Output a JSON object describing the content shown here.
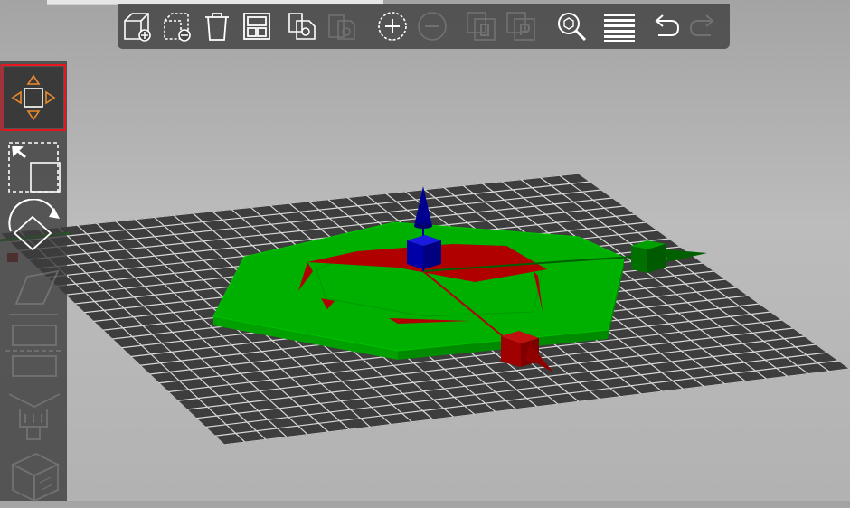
{
  "colors": {
    "toolbar_bg": "#464646",
    "icon_white": "#ffffff",
    "icon_disabled": "#8a8a8a",
    "accent_orange": "#e98a2c",
    "selection_red": "#e8141e",
    "bed_dark": "#3d3d3d",
    "bed_grid": "#d8d8d8",
    "object_green": "#00b000",
    "object_red": "#b00000",
    "axis_x": "#b00000",
    "axis_y": "#007800",
    "axis_z": "#0000a0"
  },
  "toolbar": {
    "buttons": [
      {
        "icon": "add-icon",
        "enabled": true
      },
      {
        "icon": "delete-icon",
        "enabled": true
      },
      {
        "icon": "delete-all-icon",
        "enabled": true
      },
      {
        "icon": "arrange-icon",
        "enabled": true
      },
      {
        "icon": "copy-icon",
        "enabled": true
      },
      {
        "icon": "paste-icon",
        "enabled": false
      },
      {
        "icon": "add-instance-icon",
        "enabled": true
      },
      {
        "icon": "remove-instance-icon",
        "enabled": false
      },
      {
        "icon": "split-objects-icon",
        "enabled": false
      },
      {
        "icon": "split-parts-icon",
        "enabled": false
      },
      {
        "icon": "search-icon",
        "enabled": true
      },
      {
        "icon": "layers-editing-icon",
        "enabled": true
      },
      {
        "icon": "undo-icon",
        "enabled": true
      },
      {
        "icon": "redo-icon",
        "enabled": false
      }
    ]
  },
  "gizmos": {
    "items": [
      {
        "icon": "move-icon",
        "active": true
      },
      {
        "icon": "scale-icon",
        "active": false
      },
      {
        "icon": "rotate-icon",
        "active": false
      },
      {
        "icon": "place-on-face-icon",
        "active": false,
        "enabled": false
      },
      {
        "icon": "cut-icon",
        "active": false,
        "enabled": false
      },
      {
        "icon": "paint-icon",
        "active": false,
        "enabled": false
      },
      {
        "icon": "cube-icon",
        "active": false,
        "enabled": false
      }
    ]
  }
}
